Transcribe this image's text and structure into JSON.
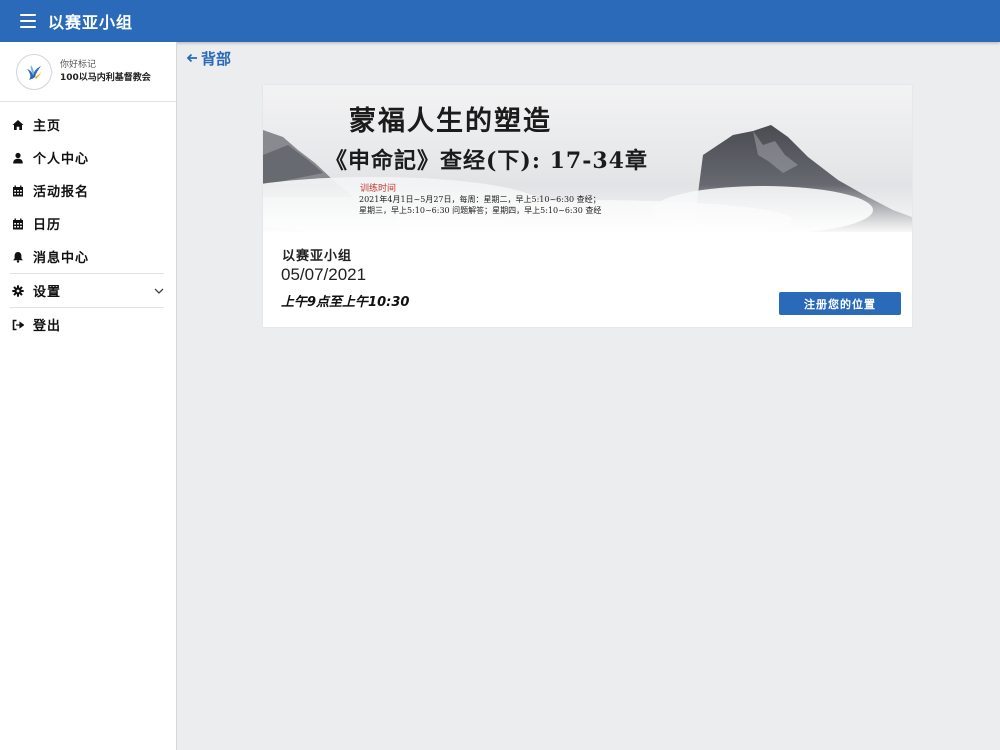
{
  "header": {
    "title": "以赛亚小组",
    "menu_icon": "hamburger-icon",
    "color": "#2a6ab8"
  },
  "profile": {
    "greeting": "你好标记",
    "church": "100以马内利基督教会",
    "avatar_icon": "dove-logo-icon"
  },
  "sidebar": {
    "items": [
      {
        "label": "主页",
        "icon": "home-icon"
      },
      {
        "label": "个人中心",
        "icon": "user-icon"
      },
      {
        "label": "活动报名",
        "icon": "calendar-icon"
      },
      {
        "label": "日历",
        "icon": "calendar-icon"
      },
      {
        "label": "消息中心",
        "icon": "bell-icon"
      },
      {
        "label": "设置",
        "icon": "gear-icon",
        "has_submenu": true
      },
      {
        "label": "登出",
        "icon": "sign-out-icon"
      }
    ]
  },
  "back": {
    "label": "背部",
    "icon": "arrow-left-icon"
  },
  "event": {
    "banner": {
      "title": "蒙福人生的塑造",
      "subtitle": "《申命記》查经(下): 17-34章",
      "label": "训练时间",
      "line1": "2021年4月1日~5月27日，每周：星期二，早上5:10~6:30 查经；",
      "line2": "星期三，早上5:10~6:30 问题解答；星期四，早上5:10~6:30 查经"
    },
    "group": "以赛亚小组",
    "date": "05/07/2021",
    "time": "上午9点至上午10:30",
    "register_label": "注册您的位置"
  }
}
